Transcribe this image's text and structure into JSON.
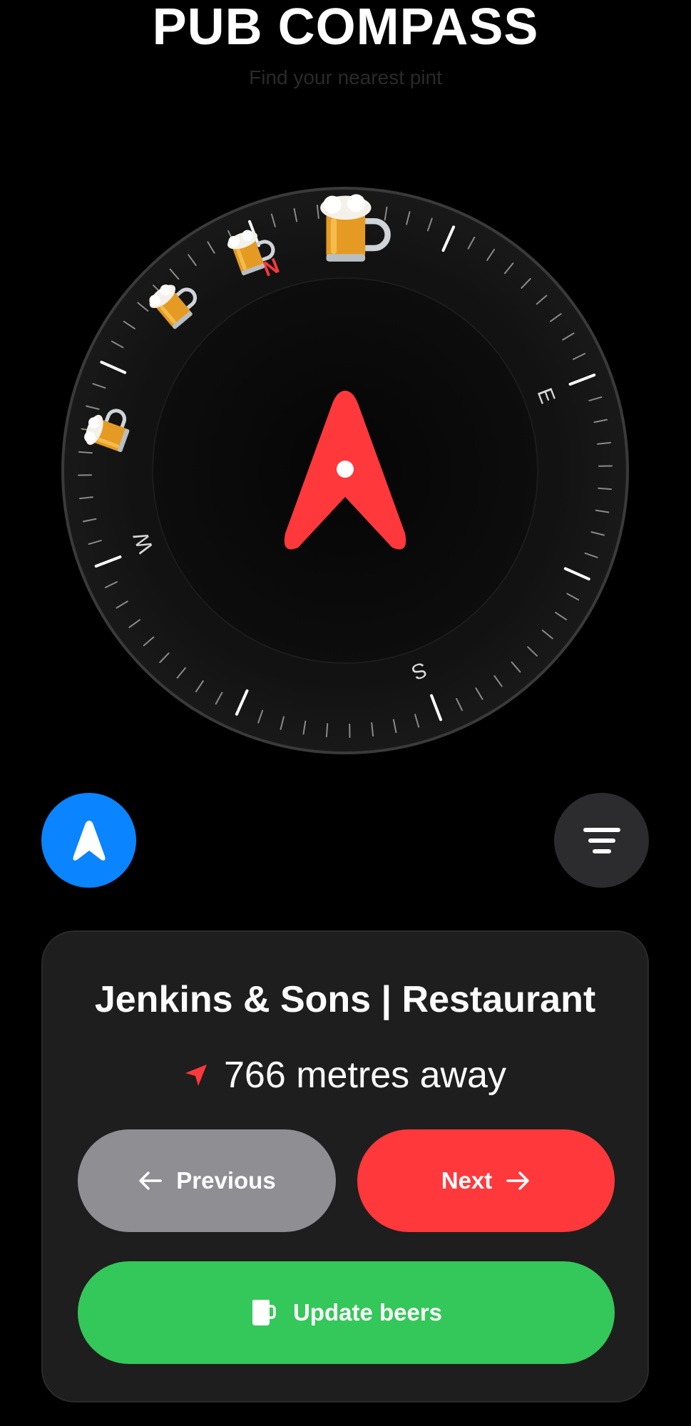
{
  "header": {
    "title": "PUB COMPASS",
    "subtitle": "Find your nearest pint"
  },
  "compass": {
    "cardinals": [
      "N",
      "E",
      "S",
      "W"
    ],
    "north_color": "#ff383c",
    "needle_color": "#ff383c",
    "pub_marker_icon": "beer-mug-icon"
  },
  "controls": {
    "locate_icon": "navigation-arrow-icon",
    "filter_icon": "filter-lines-icon"
  },
  "pub_card": {
    "name": "Jenkins & Sons | Restaurant",
    "distance": "766 metres away",
    "previous_label": "Previous",
    "next_label": "Next",
    "update_label": "Update beers"
  },
  "colors": {
    "accent_blue": "#0a84ff",
    "accent_red": "#ff383c",
    "accent_green": "#34c759",
    "neutral_gray": "#8e8e93"
  }
}
